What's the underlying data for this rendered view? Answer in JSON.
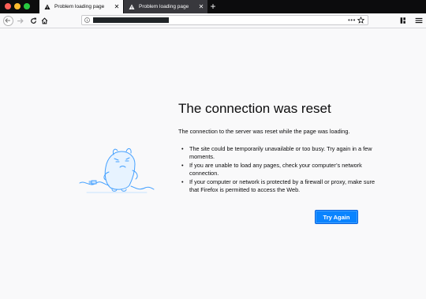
{
  "tabs": [
    {
      "label": "Problem loading page",
      "active": true
    },
    {
      "label": "Problem loading page",
      "active": false
    }
  ],
  "toolbar": {
    "url_actions": "•••"
  },
  "error": {
    "title": "The connection was reset",
    "description": "The connection to the server was reset while the page was loading.",
    "bullets": [
      "The site could be temporarily unavailable or too busy. Try again in a few moments.",
      "If you are unable to load any pages, check your computer’s network connection.",
      "If your computer or network is protected by a firewall or proxy, make sure that Firefox is permitted to access the Web."
    ],
    "try_again_label": "Try Again"
  },
  "colors": {
    "accent": "#0a84ff",
    "tab_strip": "#0c0c0d",
    "illustration": "#45a1ff"
  },
  "icons": {
    "tab": "warning-icon",
    "back": "back-arrow-icon",
    "forward": "forward-arrow-icon",
    "reload": "reload-icon",
    "home": "home-icon",
    "info": "info-icon",
    "bookmark": "star-icon",
    "library": "library-icon",
    "menu": "hamburger-menu-icon"
  }
}
